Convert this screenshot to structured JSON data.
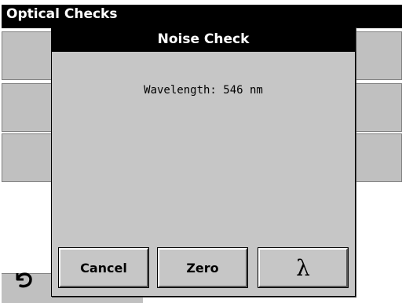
{
  "background": {
    "title": "Optical Checks"
  },
  "dialog": {
    "title": "Noise Check",
    "wavelength_text": "Wavelength: 546 nm",
    "buttons": {
      "cancel_label": "Cancel",
      "zero_label": "Zero",
      "lambda_label": "λ"
    }
  },
  "icons": {
    "back": "back-arrow-icon"
  }
}
